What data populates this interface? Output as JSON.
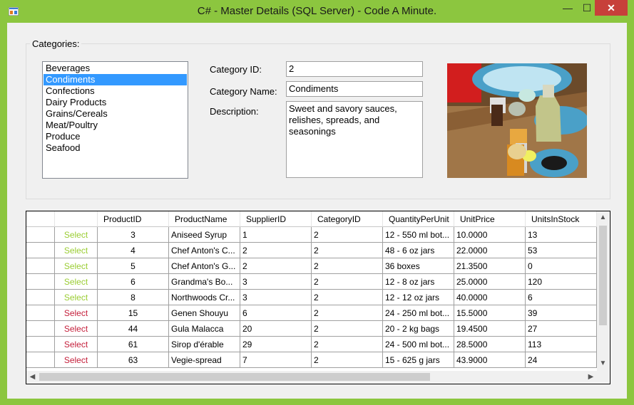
{
  "window": {
    "title": "C# - Master Details (SQL Server) - Code A Minute.",
    "controls": {
      "minimize": "—",
      "maximize": "☐",
      "close": "✕"
    },
    "accent_color": "#8cc63f"
  },
  "categories": {
    "legend": "Categories:",
    "items": [
      "Beverages",
      "Condiments",
      "Confections",
      "Dairy Products",
      "Grains/Cereals",
      "Meat/Poultry",
      "Produce",
      "Seafood"
    ],
    "selected": "Condiments"
  },
  "details": {
    "category_id_label": "Category ID:",
    "category_id_value": "2",
    "category_name_label": "Category Name:",
    "category_name_value": "Condiments",
    "description_label": "Description:",
    "description_value": "Sweet and savory sauces,\nrelishes, spreads, and\nseasonings"
  },
  "grid": {
    "columns": [
      "",
      "ProductID",
      "ProductName",
      "SupplierID",
      "CategoryID",
      "QuantityPerUnit",
      "UnitPrice",
      "UnitsInStock"
    ],
    "select_label": "Select",
    "link_colors": {
      "visited": "#9acd32",
      "unvisited": "#c41e3a"
    },
    "rows": [
      {
        "visited": true,
        "cells": [
          "3",
          "Aniseed Syrup",
          "1",
          "2",
          "12 - 550 ml bot...",
          "10.0000",
          "13"
        ]
      },
      {
        "visited": true,
        "cells": [
          "4",
          "Chef Anton's C...",
          "2",
          "2",
          "48 - 6 oz jars",
          "22.0000",
          "53"
        ]
      },
      {
        "visited": true,
        "cells": [
          "5",
          "Chef Anton's G...",
          "2",
          "2",
          "36 boxes",
          "21.3500",
          "0"
        ]
      },
      {
        "visited": true,
        "cells": [
          "6",
          "Grandma's Bo...",
          "3",
          "2",
          "12 - 8 oz jars",
          "25.0000",
          "120"
        ]
      },
      {
        "visited": true,
        "cells": [
          "8",
          "Northwoods Cr...",
          "3",
          "2",
          "12 - 12 oz jars",
          "40.0000",
          "6"
        ]
      },
      {
        "visited": false,
        "cells": [
          "15",
          "Genen Shouyu",
          "6",
          "2",
          "24 - 250 ml bot...",
          "15.5000",
          "39"
        ]
      },
      {
        "visited": false,
        "cells": [
          "44",
          "Gula Malacca",
          "20",
          "2",
          "20 - 2 kg bags",
          "19.4500",
          "27"
        ]
      },
      {
        "visited": false,
        "cells": [
          "61",
          "Sirop d'érable",
          "29",
          "2",
          "24 - 500 ml bot...",
          "28.5000",
          "113"
        ]
      },
      {
        "visited": false,
        "cells": [
          "63",
          "Vegie-spread",
          "7",
          "2",
          "15 - 625 g jars",
          "43.9000",
          "24"
        ]
      }
    ],
    "scroll_arrows": {
      "up": "▲",
      "down": "▼",
      "left": "◀",
      "right": "▶"
    }
  }
}
